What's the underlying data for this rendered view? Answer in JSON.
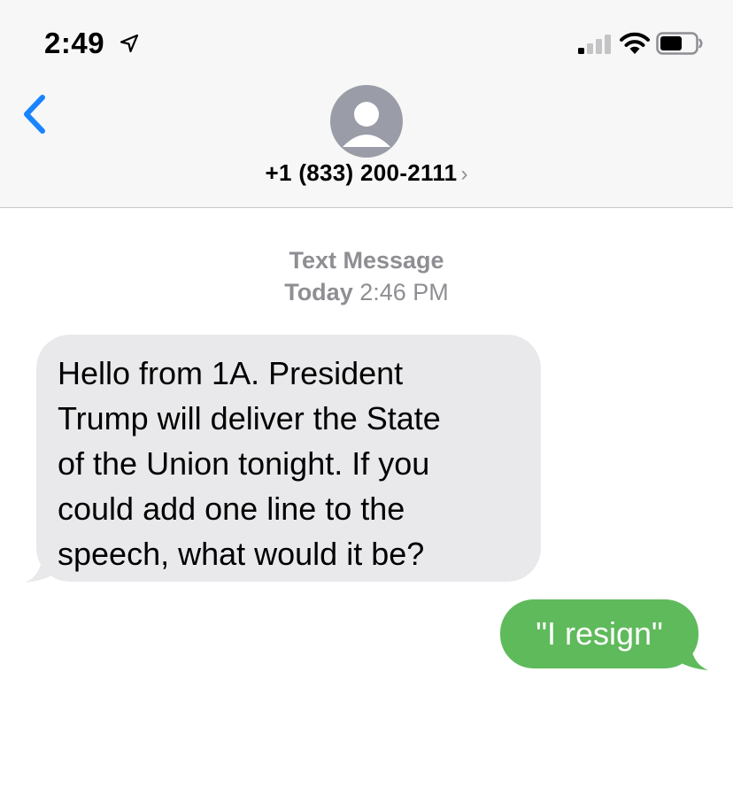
{
  "status_bar": {
    "time": "2:49",
    "icons": [
      "location-arrow-icon",
      "cellular-signal-icon",
      "wifi-icon",
      "battery-icon"
    ]
  },
  "header": {
    "back_icon": "chevron-left-icon",
    "avatar_icon": "person-silhouette-icon",
    "contact_number": "+1 (833) 200-2111",
    "contact_chevron": "›"
  },
  "conversation": {
    "service_label": "Text Message",
    "day_label": "Today",
    "time_label": "2:46 PM",
    "messages": [
      {
        "direction": "incoming",
        "text": " Hello from 1A. President\nTrump will deliver the State\nof the Union tonight. If you\ncould add one line to the\nspeech, what would it be?"
      },
      {
        "direction": "outgoing",
        "text": "\"I resign\""
      }
    ]
  },
  "colors": {
    "accent_blue": "#1a84ff",
    "incoming_bubble": "#e9e9eb",
    "outgoing_bubble": "#5fba5c",
    "header_background": "#f7f7f7",
    "secondary_text": "#8e8e93"
  }
}
